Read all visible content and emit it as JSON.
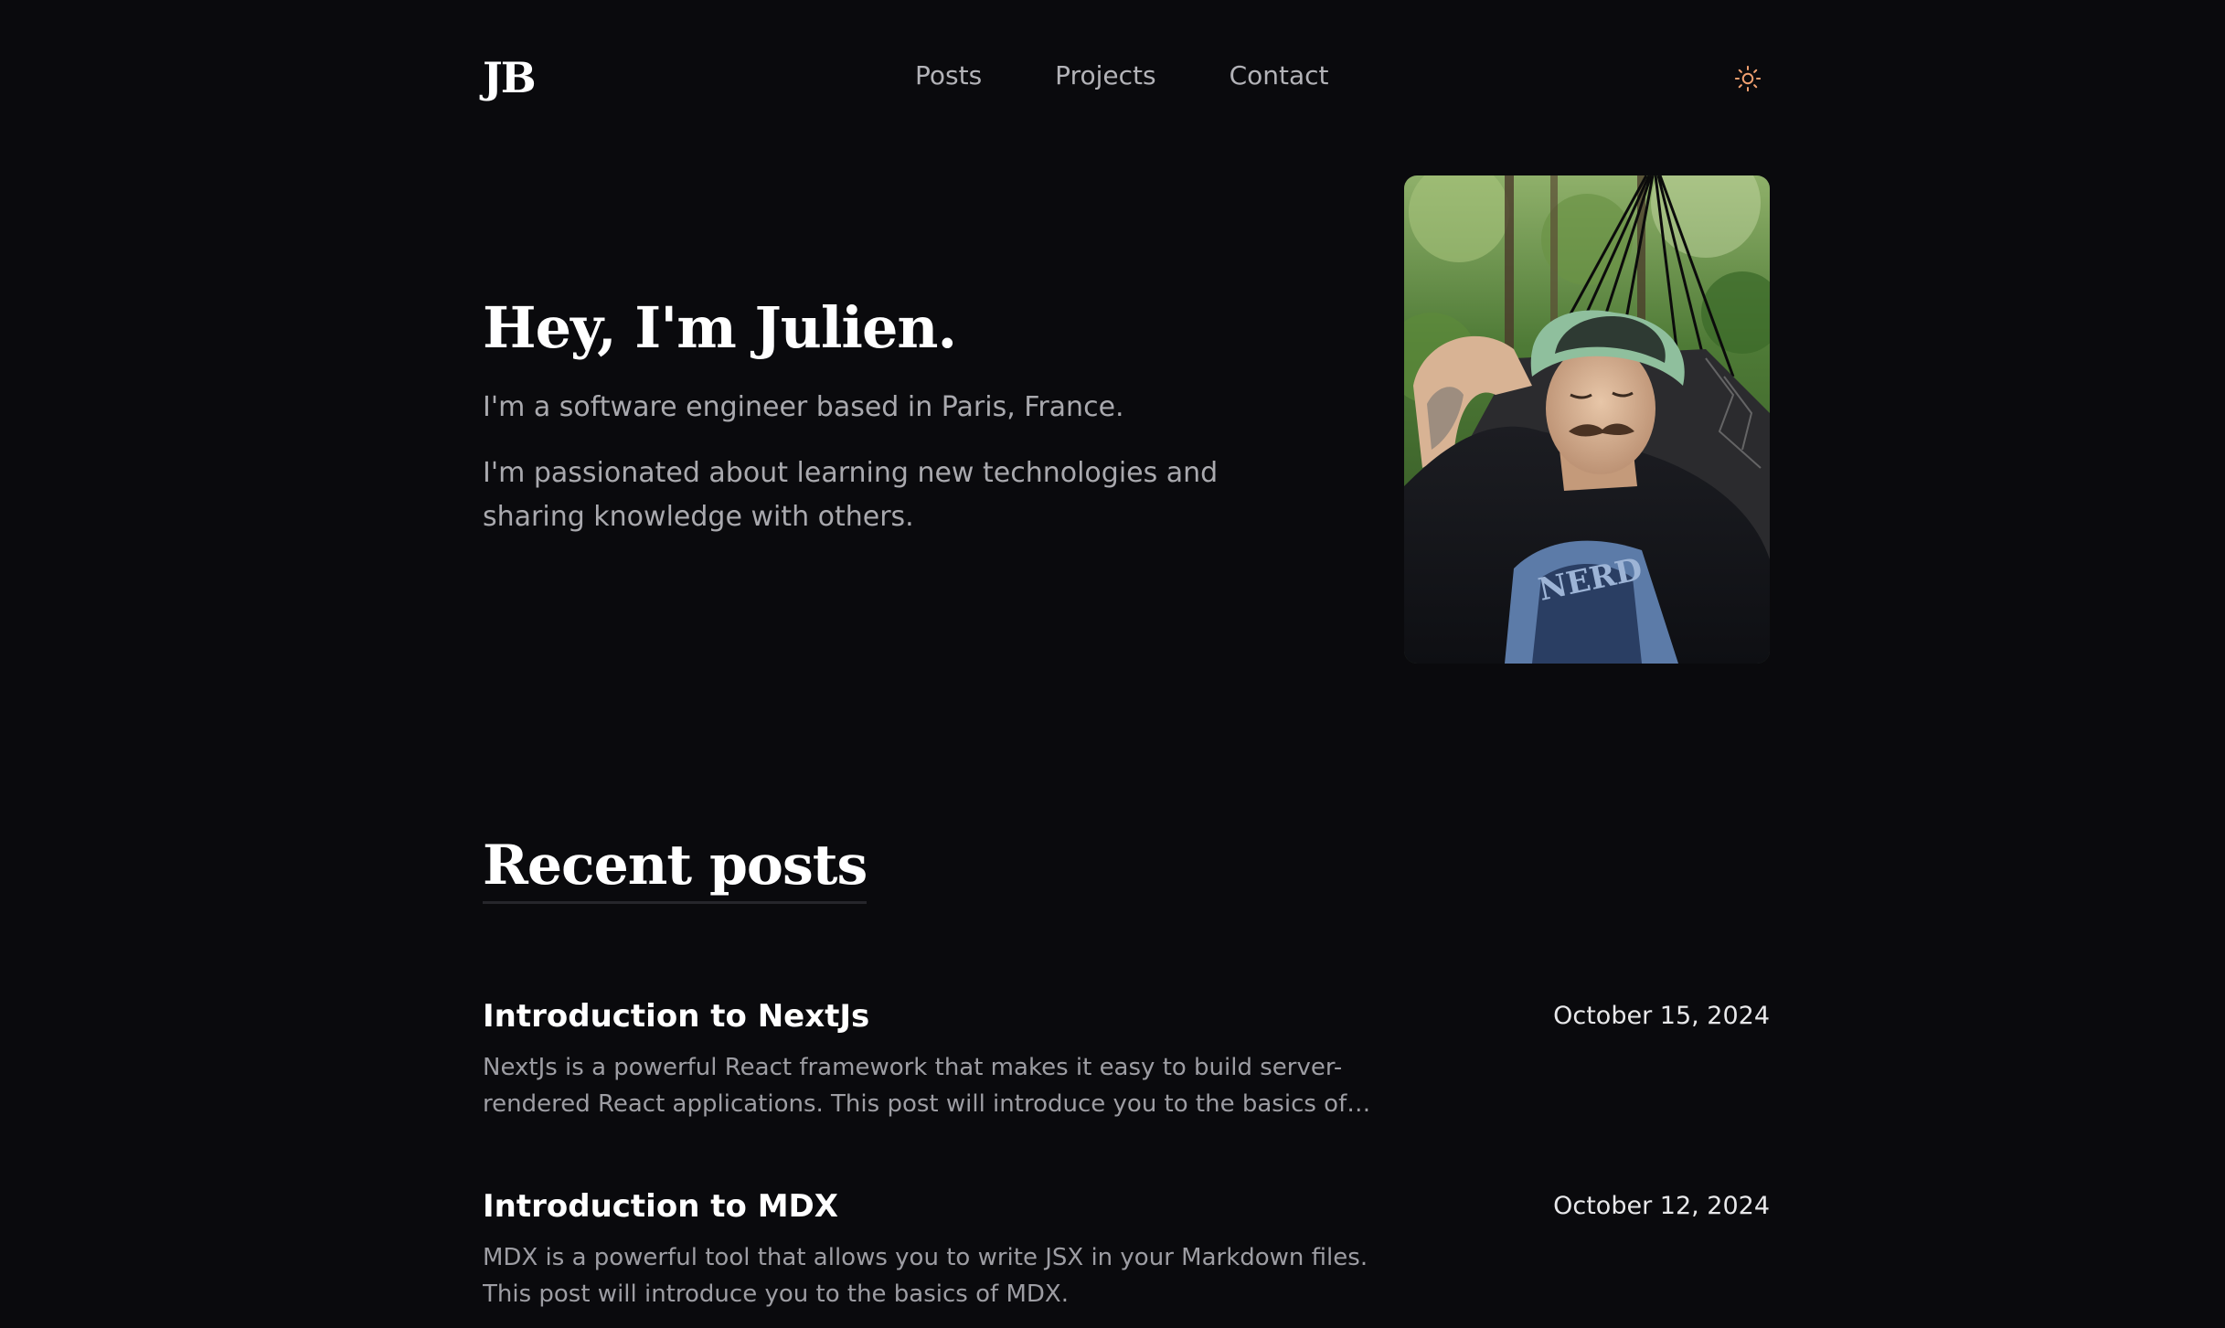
{
  "header": {
    "logo": "JB",
    "nav": [
      {
        "label": "Posts"
      },
      {
        "label": "Projects"
      },
      {
        "label": "Contact"
      }
    ],
    "theme_toggle_icon": "sun-icon",
    "accent_color": "#f0a070"
  },
  "hero": {
    "title": "Hey, I'm Julien.",
    "subtitle": "I'm a software engineer based in Paris, France.",
    "description": "I'm passionated about learning new technologies and sharing knowledge with others."
  },
  "recent_posts": {
    "heading": "Recent posts",
    "posts": [
      {
        "title": "Introduction to NextJs",
        "date": "October 15, 2024",
        "description": "NextJs is a powerful React framework that makes it easy to build server-rendered React applications. This post will introduce you to the basics of NextJs."
      },
      {
        "title": "Introduction to MDX",
        "date": "October 12, 2024",
        "description": "MDX is a powerful tool that allows you to write JSX in your Markdown files. This post will introduce you to the basics of MDX."
      }
    ]
  }
}
